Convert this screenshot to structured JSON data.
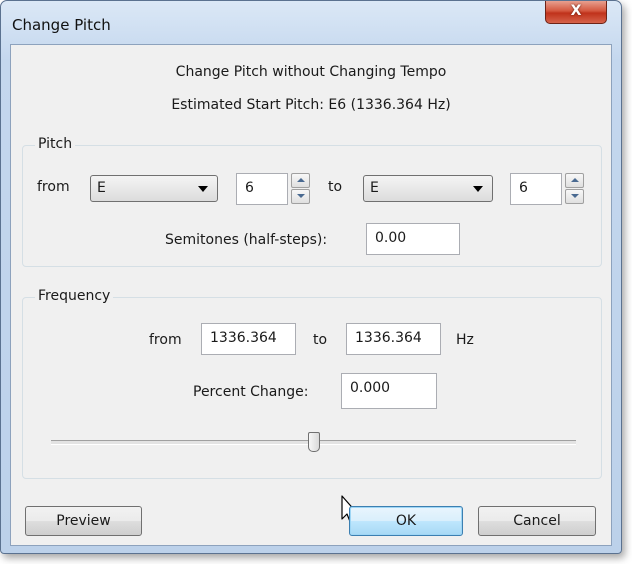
{
  "window": {
    "title": "Change Pitch",
    "close_glyph": "X"
  },
  "header": {
    "line1": "Change Pitch without Changing Tempo",
    "line2": "Estimated Start Pitch: E6 (1336.364 Hz)"
  },
  "pitch": {
    "group_label": "Pitch",
    "from_label": "from",
    "from_note": "E",
    "from_octave": "6",
    "to_label": "to",
    "to_note": "E",
    "to_octave": "6",
    "semitones_label": "Semitones (half-steps):",
    "semitones_value": "0.00"
  },
  "frequency": {
    "group_label": "Frequency",
    "from_label": "from",
    "from_value": "1336.364",
    "to_label": "to",
    "to_value": "1336.364",
    "unit": "Hz",
    "percent_label": "Percent Change:",
    "percent_value": "0.000",
    "slider_fraction": 0.5
  },
  "buttons": {
    "preview": "Preview",
    "ok": "OK",
    "cancel": "Cancel"
  }
}
